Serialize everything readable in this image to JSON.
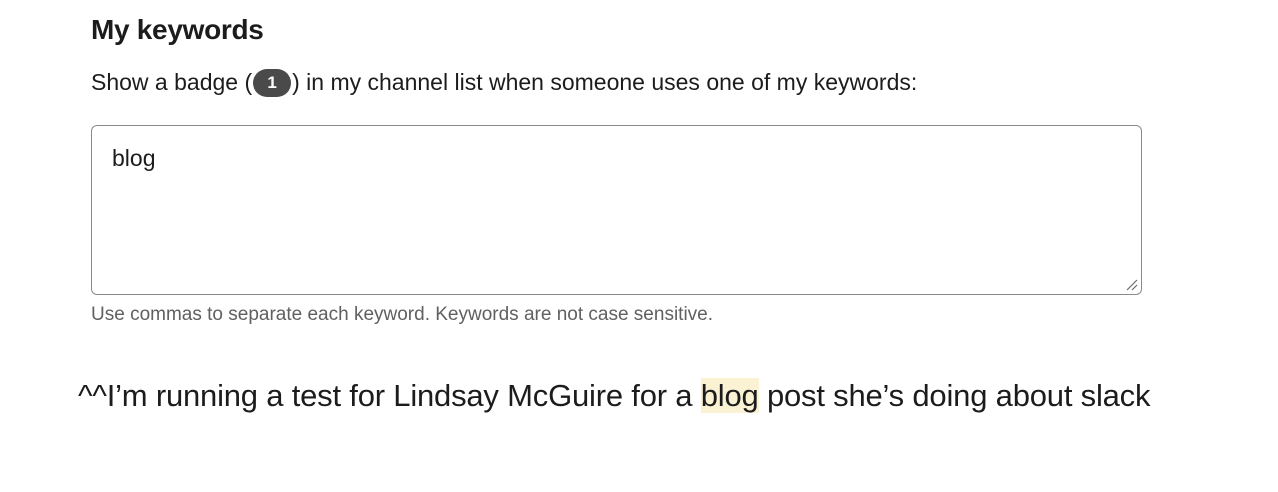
{
  "section": {
    "title": "My keywords",
    "description_before": "Show a badge (",
    "badge_count": "1",
    "description_after": ") in my channel list when someone uses one of my keywords:"
  },
  "keywords_field": {
    "value": "blog"
  },
  "hint": "Use commas to separate each keyword. Keywords are not case sensitive.",
  "comment": {
    "before": "^^I’m running a test for Lindsay McGuire for a ",
    "highlighted_word": "blog",
    "after": " post she’s doing about slack"
  },
  "colors": {
    "badge_bg": "#4a4a4a",
    "highlight_bg": "#fbf1d3",
    "border": "#8a8a8a",
    "hint_text": "#616061"
  },
  "icons": {
    "resize_handle": "resize-handle-icon"
  }
}
